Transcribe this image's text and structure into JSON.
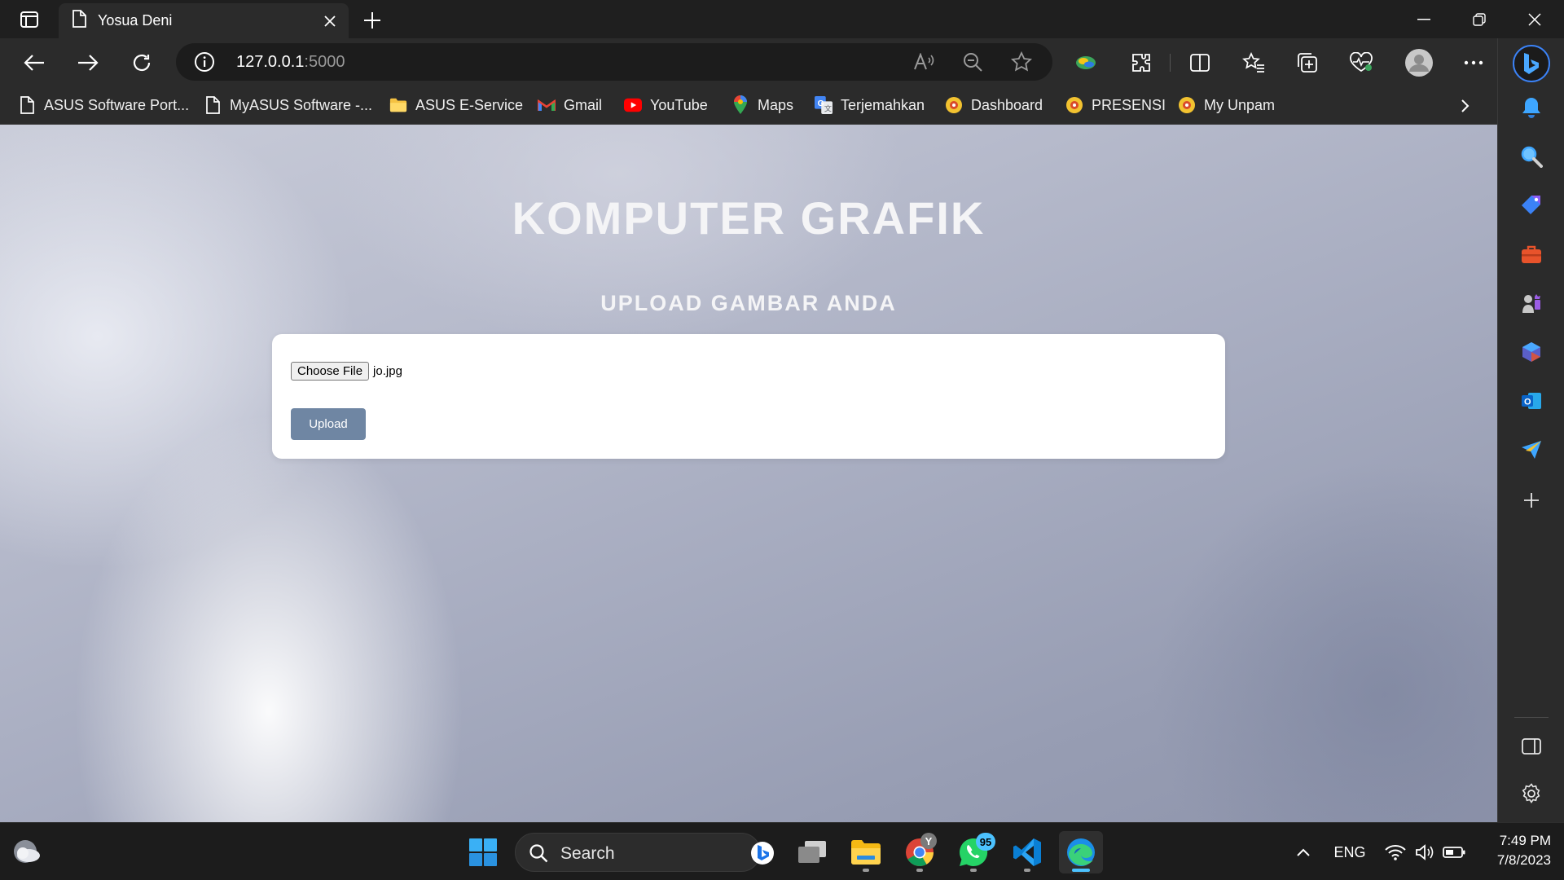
{
  "tab": {
    "title": "Yosua Deni"
  },
  "address_bar": {
    "host": "127.0.0.1",
    "port": ":5000"
  },
  "bookmarks": [
    {
      "label": "ASUS Software Port...",
      "icon": "page-icon"
    },
    {
      "label": "MyASUS Software -...",
      "icon": "page-icon"
    },
    {
      "label": "ASUS E-Service",
      "icon": "folder-icon"
    },
    {
      "label": "Gmail",
      "icon": "gmail-icon"
    },
    {
      "label": "YouTube",
      "icon": "youtube-icon"
    },
    {
      "label": "Maps",
      "icon": "maps-icon"
    },
    {
      "label": "Terjemahkan",
      "icon": "translate-icon"
    },
    {
      "label": "Dashboard",
      "icon": "unpam-icon"
    },
    {
      "label": "PRESENSI",
      "icon": "unpam-icon"
    },
    {
      "label": "My Unpam",
      "icon": "unpam-icon"
    }
  ],
  "page": {
    "title": "KOMPUTER GRAFIK",
    "subtitle": "UPLOAD GAMBAR ANDA",
    "choose_file_label": "Choose File",
    "file_name": "jo.jpg",
    "upload_label": "Upload"
  },
  "taskbar": {
    "search_label": "Search",
    "chrome_badge": "Y",
    "whatsapp_badge": "95",
    "language": "ENG",
    "time": "7:49 PM",
    "date": "7/8/2023"
  },
  "colors": {
    "upload_button": "#6f86a3",
    "accent": "#4cc2ff",
    "browser_chrome": "#2b2b2b"
  }
}
